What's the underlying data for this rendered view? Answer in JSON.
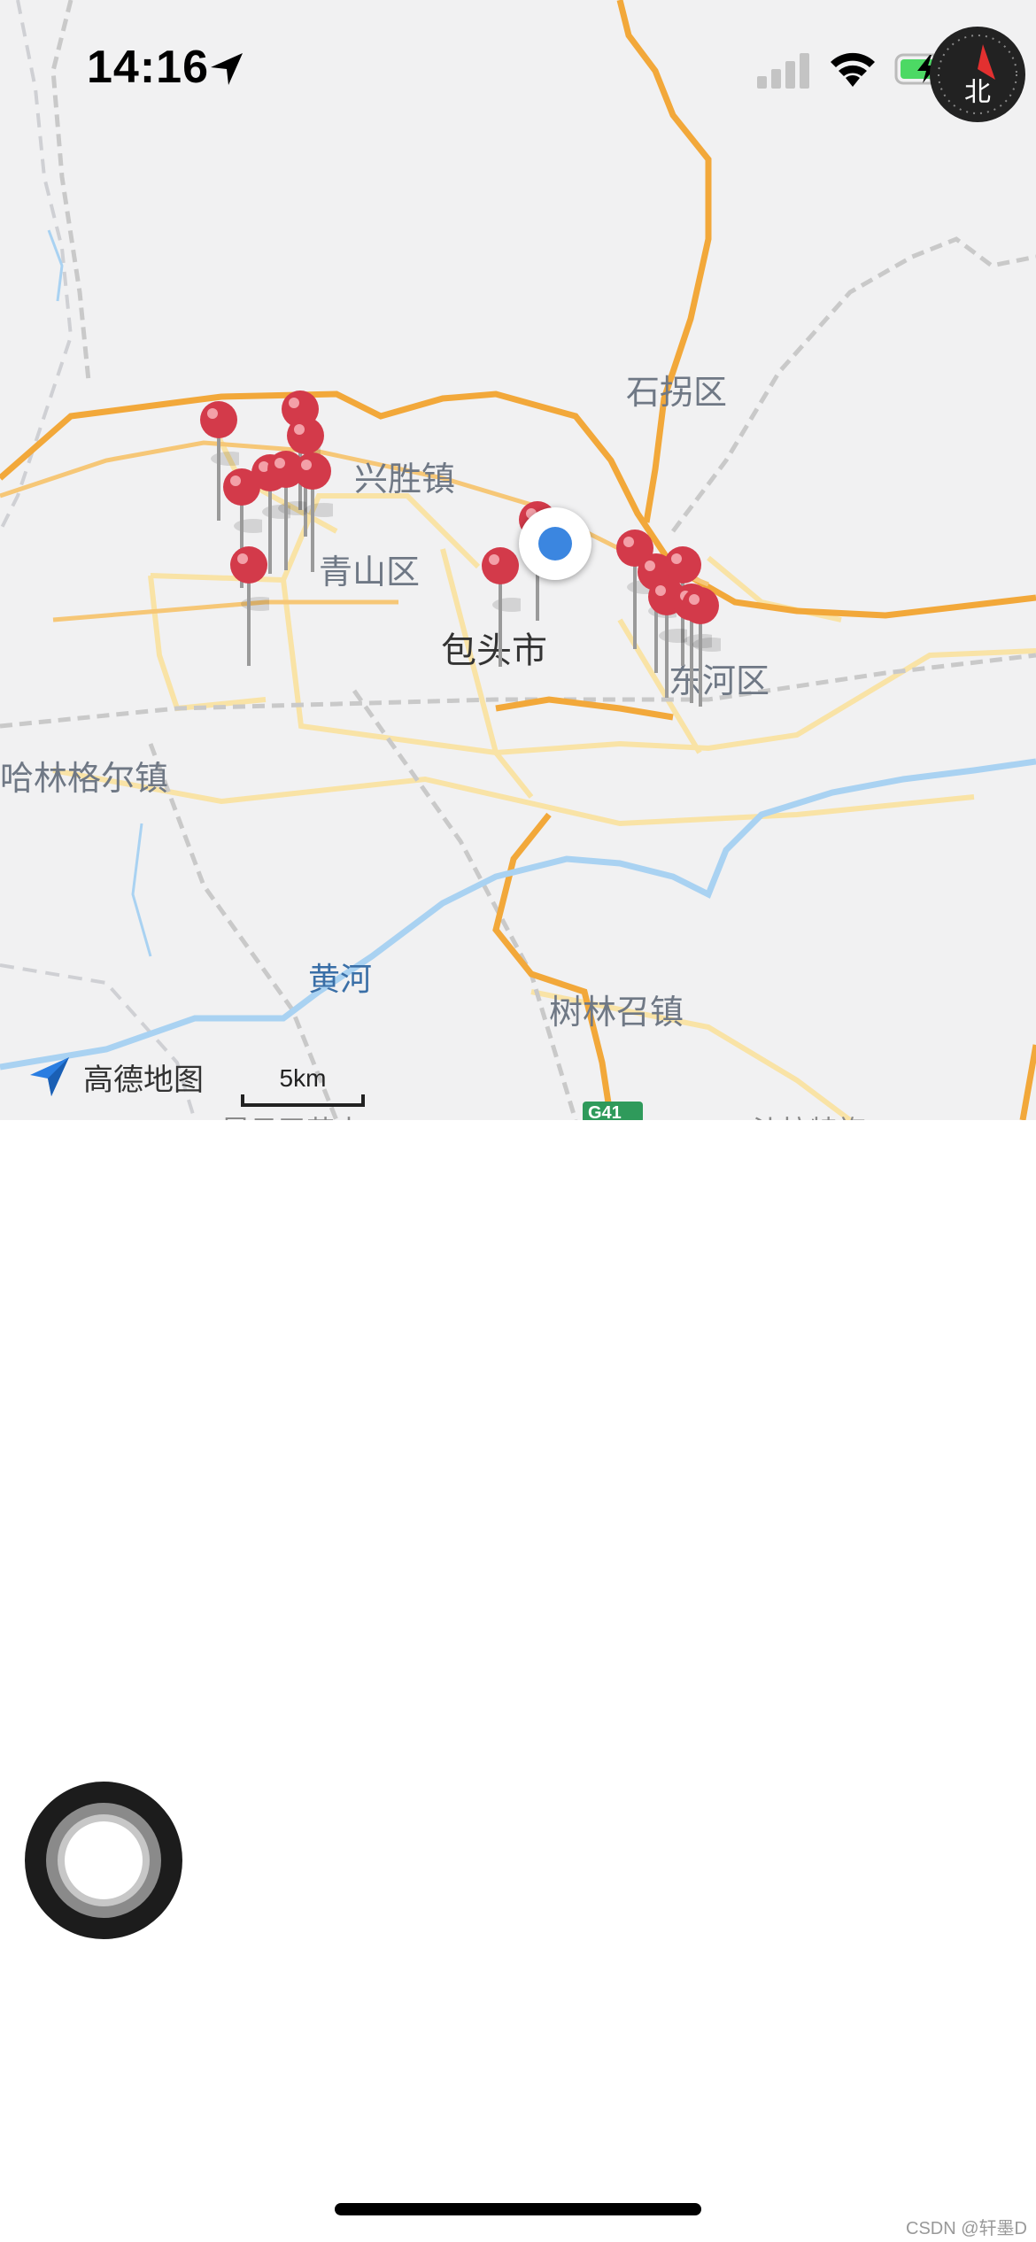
{
  "status_bar": {
    "time": "14:16",
    "compass_label": "北"
  },
  "map": {
    "places": [
      {
        "name": "石拐区",
        "type": "district"
      },
      {
        "name": "兴胜镇",
        "type": "town"
      },
      {
        "name": "青山区",
        "type": "district"
      },
      {
        "name": "包头市",
        "type": "city"
      },
      {
        "name": "东河区",
        "type": "district"
      },
      {
        "name": "哈林格尔镇",
        "type": "town"
      },
      {
        "name": "黄河",
        "type": "river"
      },
      {
        "name": "树林召镇",
        "type": "town"
      },
      {
        "name": "昆日召苏木",
        "type": "town"
      },
      {
        "name": "沙拉特旗",
        "type": "town"
      }
    ],
    "road_shield": "G41",
    "logo_text": "高德地图",
    "scale_label": "5km",
    "pin_count": 16
  },
  "watermark": "CSDN @轩墨D"
}
